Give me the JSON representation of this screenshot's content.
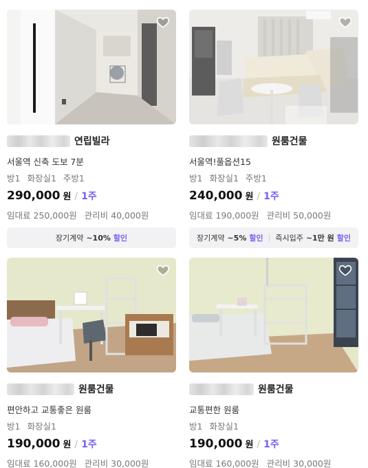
{
  "listings": [
    {
      "building_type": "연립빌라",
      "description": "서울역 신축 도보 7분",
      "rooms": [
        "방1",
        "화장실1",
        "주방1"
      ],
      "price": "290,000",
      "price_unit": "원",
      "period": "1주",
      "deposit": "임대료 250,000원",
      "maintenance": "관리비 40,000원",
      "promotions": [
        {
          "label": "장기계약",
          "value": "~10%",
          "tag": "할인"
        }
      ]
    },
    {
      "building_type": "원룸건물",
      "description": "서울역!풀옵션15",
      "rooms": [
        "방1",
        "화장실1",
        "주방1"
      ],
      "price": "240,000",
      "price_unit": "원",
      "period": "1주",
      "deposit": "임대료 190,000원",
      "maintenance": "관리비 50,000원",
      "promotions": [
        {
          "label": "장기계약",
          "value": "~5%",
          "tag": "할인"
        },
        {
          "label": "즉시입주",
          "value": "~1만 원",
          "tag": "할인"
        }
      ]
    },
    {
      "building_type": "원룸건물",
      "description": "편안하고 교통좋은 원룸",
      "rooms": [
        "방1",
        "화장실1"
      ],
      "price": "190,000",
      "price_unit": "원",
      "period": "1주",
      "deposit": "임대료 160,000원",
      "maintenance": "관리비 30,000원"
    },
    {
      "building_type": "원룸건물",
      "description": "교통편한 원룸",
      "rooms": [
        "방1",
        "화장실1"
      ],
      "price": "190,000",
      "price_unit": "원",
      "period": "1주",
      "deposit": "임대료 160,000원",
      "maintenance": "관리비 30,000원"
    }
  ],
  "slash": "/",
  "icons": {
    "favorite": "heart-outline-icon"
  },
  "colors": {
    "accent": "#7b5cf5",
    "promo_bg": "#f2f2f4"
  }
}
